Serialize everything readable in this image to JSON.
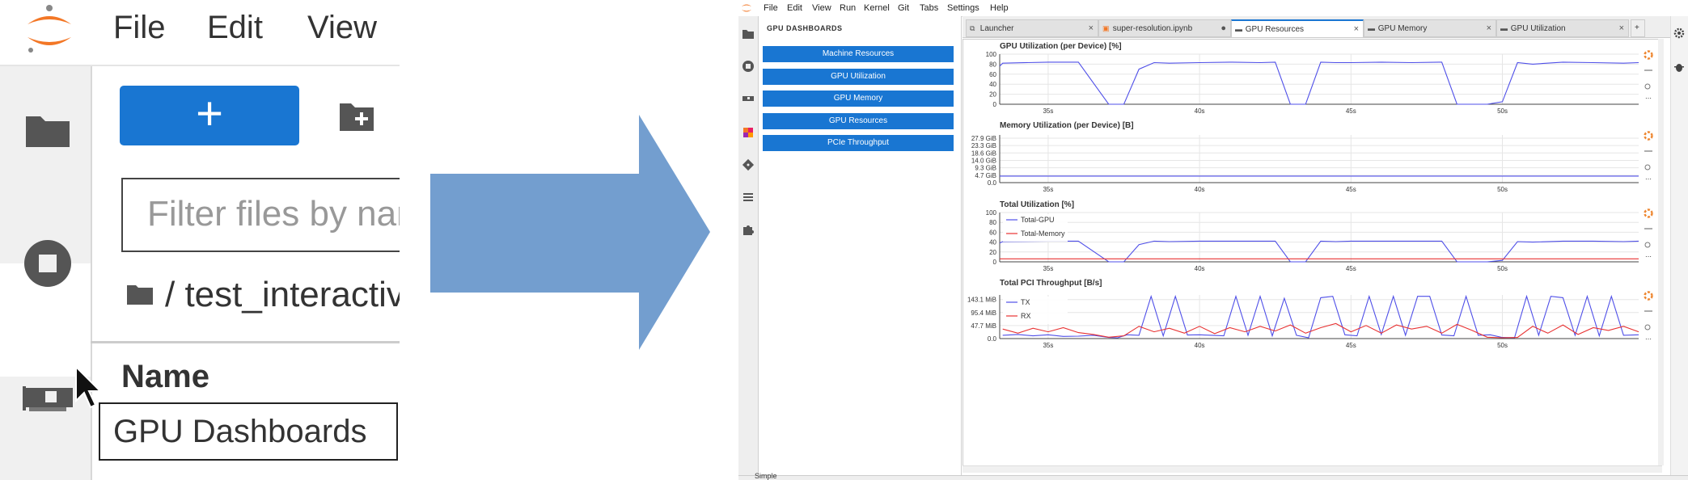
{
  "zoom": {
    "menu": [
      "File",
      "Edit",
      "View"
    ],
    "new_button_label": "+",
    "filter_placeholder": "Filter files by nar",
    "breadcrumb": "/ test_interactive",
    "column_header": "Name",
    "tooltip": "GPU Dashboards"
  },
  "menubar": [
    "File",
    "Edit",
    "View",
    "Run",
    "Kernel",
    "Git",
    "Tabs",
    "Settings",
    "Help"
  ],
  "panel": {
    "title": "GPU DASHBOARDS",
    "buttons": [
      "Machine Resources",
      "GPU Utilization",
      "GPU Memory",
      "GPU Resources",
      "PCIe Throughput"
    ]
  },
  "tabs": [
    {
      "label": "Launcher",
      "icon": "launcher-icon",
      "close": "×"
    },
    {
      "label": "super-resolution.ipynb",
      "icon": "notebook-icon",
      "close": "●"
    },
    {
      "label": "GPU Resources",
      "icon": "gpu-card-icon",
      "close": "×",
      "active": true
    },
    {
      "label": "GPU Memory",
      "icon": "gpu-card-icon",
      "close": "×"
    },
    {
      "label": "GPU Utilization",
      "icon": "gpu-card-icon",
      "close": "×"
    }
  ],
  "add_tab": "+",
  "status": {
    "mode": "Simple"
  },
  "colors": {
    "accent": "#1976d2",
    "series_blue": "#4f4fe8",
    "series_red": "#e83232",
    "arrow": "#739ecf"
  },
  "chart_data": [
    {
      "type": "line",
      "title": "GPU Utilization (per Device) [%]",
      "ylim": [
        0,
        100
      ],
      "y_ticks": [
        "0",
        "20",
        "40",
        "60",
        "80",
        "100"
      ],
      "x": [
        33.4,
        33.5,
        35.0,
        36.0,
        37.0,
        37.5,
        38.0,
        38.5,
        39.0,
        40.0,
        41.0,
        42.0,
        42.5,
        43.0,
        43.5,
        44.0,
        44.5,
        45.0,
        46.0,
        47.0,
        48.0,
        48.5,
        49.0,
        49.5,
        50.0,
        50.5,
        51.0,
        52.0,
        53.0,
        54.0,
        54.5
      ],
      "values": [
        76,
        82,
        84,
        84,
        0,
        0,
        70,
        83,
        82,
        83,
        84,
        83,
        84,
        0,
        0,
        84,
        83,
        83,
        84,
        83,
        84,
        0,
        0,
        0,
        5,
        83,
        80,
        84,
        83,
        82,
        83
      ],
      "x_ticks": [
        "35s",
        "40s",
        "45s",
        "50s"
      ],
      "grid": true
    },
    {
      "type": "line",
      "title": "Memory Utilization (per Device) [B]",
      "y_ticks": [
        "0.0",
        "4.7 GiB",
        "9.3 GiB",
        "14.0 GiB",
        "18.6 GiB",
        "23.3 GiB",
        "27.9 GiB"
      ],
      "ylim": [
        0,
        29.9
      ],
      "x": [
        33.4,
        54.5
      ],
      "values": [
        4.1,
        4.1
      ],
      "x_ticks": [
        "35s",
        "40s",
        "45s",
        "50s"
      ],
      "grid": true
    },
    {
      "type": "line",
      "title": "Total Utilization [%]",
      "ylim": [
        0,
        100
      ],
      "y_ticks": [
        "0",
        "20",
        "40",
        "60",
        "80",
        "100"
      ],
      "legend": [
        "Total-GPU",
        "Total-Memory"
      ],
      "legend_position": "top-left",
      "x_ticks": [
        "35s",
        "40s",
        "45s",
        "50s"
      ],
      "series": [
        {
          "name": "Total-GPU",
          "x": [
            33.4,
            33.5,
            35.0,
            36.0,
            37.0,
            37.5,
            38.0,
            38.5,
            39.0,
            40.0,
            41.0,
            42.0,
            42.5,
            43.0,
            43.5,
            44.0,
            44.5,
            45.0,
            46.0,
            47.0,
            48.0,
            48.5,
            49.0,
            49.5,
            50.0,
            50.5,
            51.0,
            52.0,
            53.0,
            54.0,
            54.5
          ],
          "values": [
            38,
            41,
            42,
            42,
            0,
            0,
            35,
            42,
            41,
            42,
            42,
            42,
            42,
            0,
            0,
            42,
            41,
            42,
            42,
            42,
            42,
            0,
            0,
            0,
            3,
            41,
            40,
            42,
            42,
            41,
            42
          ]
        },
        {
          "name": "Total-Memory",
          "x": [
            33.4,
            54.5
          ],
          "values": [
            6,
            6
          ]
        }
      ],
      "grid": true
    },
    {
      "type": "line",
      "title": "Total PCI Throughput [B/s]",
      "y_ticks": [
        "0.0",
        "47.7 MiB",
        "95.4 MiB",
        "143.1 MiB"
      ],
      "ylim": [
        0,
        160
      ],
      "legend": [
        "TX",
        "RX"
      ],
      "legend_position": "top-left",
      "x_ticks": [
        "35s",
        "40s",
        "45s",
        "50s"
      ],
      "series": [
        {
          "name": "TX",
          "x": [
            33.5,
            34.0,
            34.5,
            35.0,
            35.5,
            36.0,
            36.5,
            37.0,
            37.3,
            37.6,
            38.0,
            38.4,
            38.8,
            39.2,
            39.6,
            40.0,
            40.4,
            40.8,
            41.2,
            41.6,
            42.0,
            42.4,
            42.8,
            43.2,
            43.6,
            44.0,
            44.4,
            44.8,
            45.2,
            45.6,
            46.0,
            46.4,
            46.8,
            47.2,
            47.6,
            48.0,
            48.4,
            48.8,
            49.2,
            49.6,
            50.0,
            50.4,
            50.8,
            51.2,
            51.6,
            52.0,
            52.4,
            52.8,
            53.2,
            53.6,
            54.0,
            54.5
          ],
          "values": [
            12,
            15,
            10,
            14,
            8,
            9,
            12,
            4,
            3,
            14,
            12,
            155,
            10,
            155,
            13,
            14,
            12,
            10,
            155,
            12,
            155,
            10,
            148,
            12,
            3,
            150,
            155,
            14,
            10,
            155,
            15,
            155,
            12,
            155,
            155,
            13,
            10,
            155,
            12,
            14,
            4,
            3,
            155,
            12,
            155,
            150,
            12,
            155,
            10,
            155,
            12,
            14
          ]
        },
        {
          "name": "RX",
          "x": [
            33.5,
            34.0,
            34.5,
            35.0,
            35.5,
            36.0,
            36.5,
            37.0,
            37.5,
            38.0,
            38.5,
            39.0,
            39.5,
            40.0,
            40.5,
            41.0,
            41.5,
            42.0,
            42.5,
            43.0,
            43.5,
            44.0,
            44.5,
            45.0,
            45.5,
            46.0,
            46.5,
            47.0,
            47.5,
            48.0,
            48.5,
            49.0,
            49.5,
            50.0,
            50.5,
            51.0,
            51.5,
            52.0,
            52.5,
            53.0,
            53.5,
            54.0,
            54.5
          ],
          "values": [
            35,
            20,
            38,
            25,
            40,
            22,
            15,
            5,
            10,
            45,
            25,
            38,
            20,
            45,
            18,
            40,
            25,
            45,
            28,
            50,
            20,
            40,
            55,
            25,
            48,
            20,
            50,
            35,
            45,
            20,
            52,
            30,
            5,
            3,
            4,
            45,
            20,
            50,
            15,
            40,
            30,
            45,
            25
          ]
        }
      ],
      "grid": true
    }
  ]
}
